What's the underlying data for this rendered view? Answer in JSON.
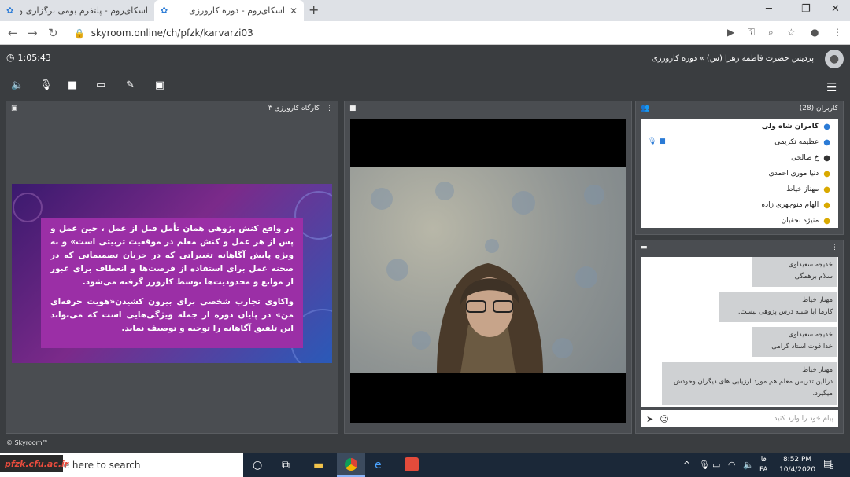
{
  "browser": {
    "tabs": [
      {
        "title": "اسکای‌روم - پلتفرم بومی برگزاری وب"
      },
      {
        "title": "اسکای‌روم - دوره کارورزی"
      }
    ],
    "url": "skyroom.online/ch/pfzk/karvarzi03"
  },
  "app": {
    "timer": "1:05:43",
    "room_title": "پردیس حضرت فاطمه زهرا (س) » دوره کارورزی",
    "presentation": {
      "title": "کارگاه کارورزی ۳",
      "paragraphs": [
        "در واقع کنش پژوهی همان تأمل قبل از عمل ، حین عمل و پس از هر عمل و کنش معلم در موقعیت تربیتی است» و به ویژه پایش آگاهانه تغییراتی که در جریان تصمیماتی که در صحنه عمل برای استفاده از فرصت‌ها و انعطاف برای عبور از موانع و محدودیت‌ها توسط کارورز گرفته می‌شود.",
        "واکاوی تجارب شخصی برای بیرون کشیدن«هویت حرفه‌ای من» در پایان دوره از جمله ویژگی‌هایی است که می‌تواند این تلفیق آگاهانه را توجیه و توصیف نماید."
      ]
    },
    "users": {
      "header": "کاربران (28)",
      "list": [
        {
          "name": "کامران شاه ولی"
        },
        {
          "name": "عظیمه تکریمی"
        },
        {
          "name": "خ صالحی"
        },
        {
          "name": "دنیا موری احمدی"
        },
        {
          "name": "مهناز خیاط"
        },
        {
          "name": "الهام منوچهری زاده"
        },
        {
          "name": "منیژه نجفیان"
        }
      ]
    },
    "chat": {
      "messages": [
        {
          "name": "خدیجه سعیداوی",
          "text": "سلام برهمگی"
        },
        {
          "name": "مهناز خیاط",
          "text": "کارما ایا شبیه درس پژوهی نیست."
        },
        {
          "name": "خدیجه سعیداوی",
          "text": "خدا قوت استاد گرامی"
        },
        {
          "name": "مهناز خیاط",
          "text": "درااین تدریس معلم هم مورد ارزیابی های  دیگران وخودش میگیرد."
        }
      ],
      "input_placeholder": "پیام خود را وارد کنید"
    },
    "footer": "© Skyroom™"
  },
  "taskbar": {
    "search_placeholder": "ype here to search",
    "watermark": "pfzk.cfu.ac.ir",
    "time": "8:52 PM",
    "date": "10/4/2020",
    "lang_top": "فا",
    "lang_bottom": "FA",
    "notification_count": "5"
  }
}
